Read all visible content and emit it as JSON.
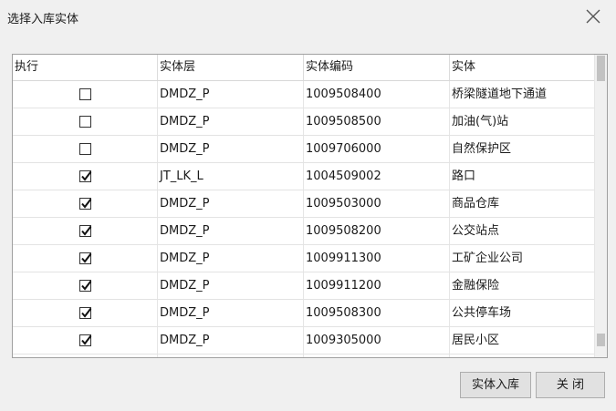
{
  "dialog": {
    "title": "选择入库实体",
    "close_icon": "close-x-icon"
  },
  "table": {
    "columns": [
      "执行",
      "实体层",
      "实体编码",
      "实体"
    ],
    "rows": [
      {
        "checked": false,
        "layer": "DMDZ_P",
        "code": "1009508400",
        "entity": "桥梁隧道地下通道"
      },
      {
        "checked": false,
        "layer": "DMDZ_P",
        "code": "1009508500",
        "entity": "加油(气)站"
      },
      {
        "checked": false,
        "layer": "DMDZ_P",
        "code": "1009706000",
        "entity": "自然保护区"
      },
      {
        "checked": true,
        "layer": "JT_LK_L",
        "code": "1004509002",
        "entity": "路口"
      },
      {
        "checked": true,
        "layer": "DMDZ_P",
        "code": "1009503000",
        "entity": "商品仓库"
      },
      {
        "checked": true,
        "layer": "DMDZ_P",
        "code": "1009508200",
        "entity": "公交站点"
      },
      {
        "checked": true,
        "layer": "DMDZ_P",
        "code": "1009911300",
        "entity": "工矿企业公司"
      },
      {
        "checked": true,
        "layer": "DMDZ_P",
        "code": "1009911200",
        "entity": "金融保险"
      },
      {
        "checked": true,
        "layer": "DMDZ_P",
        "code": "1009508300",
        "entity": "公共停车场"
      },
      {
        "checked": true,
        "layer": "DMDZ_P",
        "code": "1009305000",
        "entity": "居民小区"
      },
      {
        "checked": true,
        "layer": "",
        "code": "",
        "entity": ""
      }
    ]
  },
  "buttons": {
    "import_label": "实体入库",
    "close_label": "关 闭"
  }
}
